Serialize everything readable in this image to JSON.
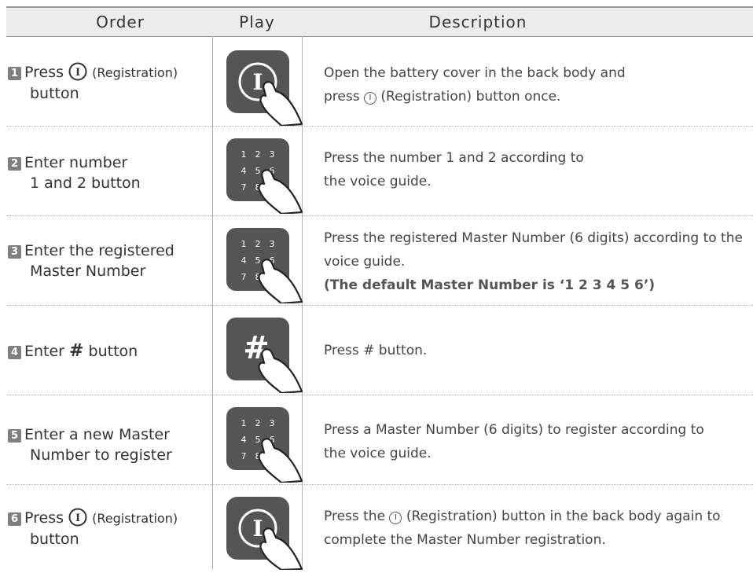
{
  "header": {
    "order": "Order",
    "play": "Play",
    "description": "Description"
  },
  "rows": [
    {
      "num": "1",
      "order_line1_pre": "Press",
      "order_line1_post": "(Registration)",
      "order_line2": "button",
      "play_icon": "registration-button-icon",
      "desc_line1": "Open the battery cover in the back body and",
      "desc_line2_pre": "press",
      "desc_line2_post": "(Registration) button once."
    },
    {
      "num": "2",
      "order_line1": "Enter number",
      "order_line2": "1 and 2 button",
      "play_icon": "keypad-icon",
      "desc_line1": "Press the number 1 and 2 according to",
      "desc_line2": "the voice guide."
    },
    {
      "num": "3",
      "order_line1": "Enter the registered",
      "order_line2": "Master Number",
      "play_icon": "keypad-icon",
      "desc_line1": "Press the registered Master Number (6 digits) according to the",
      "desc_line2": "voice guide.",
      "desc_line3": "(The default Master Number is ‘1 2 3 4 5 6’)"
    },
    {
      "num": "4",
      "order_line1_pre": "Enter",
      "order_symbol": "#",
      "order_line1_post": "button",
      "play_icon": "hash-button-icon",
      "desc_line1": "Press # button."
    },
    {
      "num": "5",
      "order_line1": "Enter a new Master",
      "order_line2": "Number to register",
      "play_icon": "keypad-icon",
      "desc_line1": "Press a Master Number (6 digits) to register according to",
      "desc_line2": "the voice guide."
    },
    {
      "num": "6",
      "order_line1_pre": "Press",
      "order_line1_post": "(Registration)",
      "order_line2": "button",
      "play_icon": "registration-button-icon",
      "desc_line1_pre": "Press the",
      "desc_line1_post": "(Registration) button in the back body again to",
      "desc_line2": "complete the Master Number registration."
    }
  ],
  "symbols": {
    "registration": "I",
    "keypad_digits": [
      "1",
      "2",
      "3",
      "4",
      "5",
      "6",
      "7",
      "8"
    ]
  },
  "colors": {
    "icon_dark": "#555555",
    "header_bg": "#ececec",
    "badge": "#7f7f7f"
  }
}
